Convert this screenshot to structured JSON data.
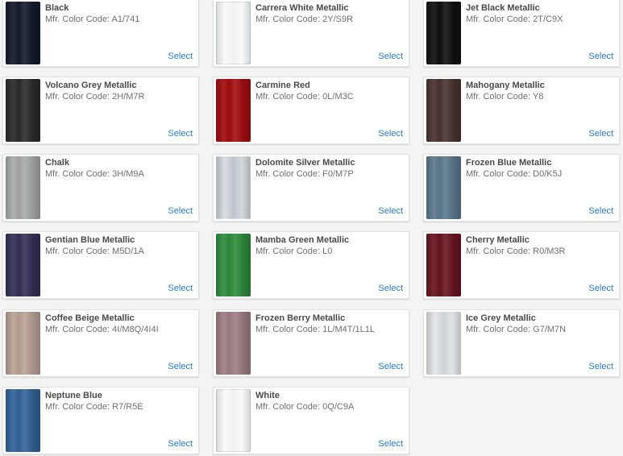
{
  "code_prefix": "Mfr. Color Code:",
  "select_label": "Select",
  "colors": [
    {
      "name": "Black",
      "code": "A1/741",
      "swatch": "#141a2c"
    },
    {
      "name": "Carrera White Metallic",
      "code": "2Y/S9R",
      "swatch": "#f4f6f7",
      "light": true
    },
    {
      "name": "Jet Black Metallic",
      "code": "2T/C9X",
      "swatch": "#101010"
    },
    {
      "name": "Volcano Grey Metallic",
      "code": "2H/M7R",
      "swatch": "#2b2b2b"
    },
    {
      "name": "Carmine Red",
      "code": "0L/M3C",
      "swatch": "#a30d10"
    },
    {
      "name": "Mahogany Metallic",
      "code": "Y8",
      "swatch": "#4a3430"
    },
    {
      "name": "Chalk",
      "code": "3H/M9A",
      "swatch": "#a9aaaa"
    },
    {
      "name": "Dolomite Silver Metallic",
      "code": "F0/M7P",
      "swatch": "#c1c8cf",
      "light": true
    },
    {
      "name": "Frozen Blue Metallic",
      "code": "D0/K5J",
      "swatch": "#5c7a8e"
    },
    {
      "name": "Gentian Blue Metallic",
      "code": "M5D/1A",
      "swatch": "#343058"
    },
    {
      "name": "Mamba Green Metallic",
      "code": "L0",
      "swatch": "#2f8c3d"
    },
    {
      "name": "Cherry Metallic",
      "code": "R0/M3R",
      "swatch": "#6a1520"
    },
    {
      "name": "Coffee Beige Metallic",
      "code": "4I/M8Q/4I4I",
      "swatch": "#bba296"
    },
    {
      "name": "Frozen Berry Metallic",
      "code": "1L/M4T/1L1L",
      "swatch": "#9e7f84"
    },
    {
      "name": "Ice Grey Metallic",
      "code": "G7/M7N",
      "swatch": "#d3d7db",
      "light": true
    },
    {
      "name": "Neptune Blue",
      "code": "R7/R5E",
      "swatch": "#33639a"
    },
    {
      "name": "White",
      "code": "0Q/C9A",
      "swatch": "#f6f6f6",
      "light": true
    }
  ]
}
